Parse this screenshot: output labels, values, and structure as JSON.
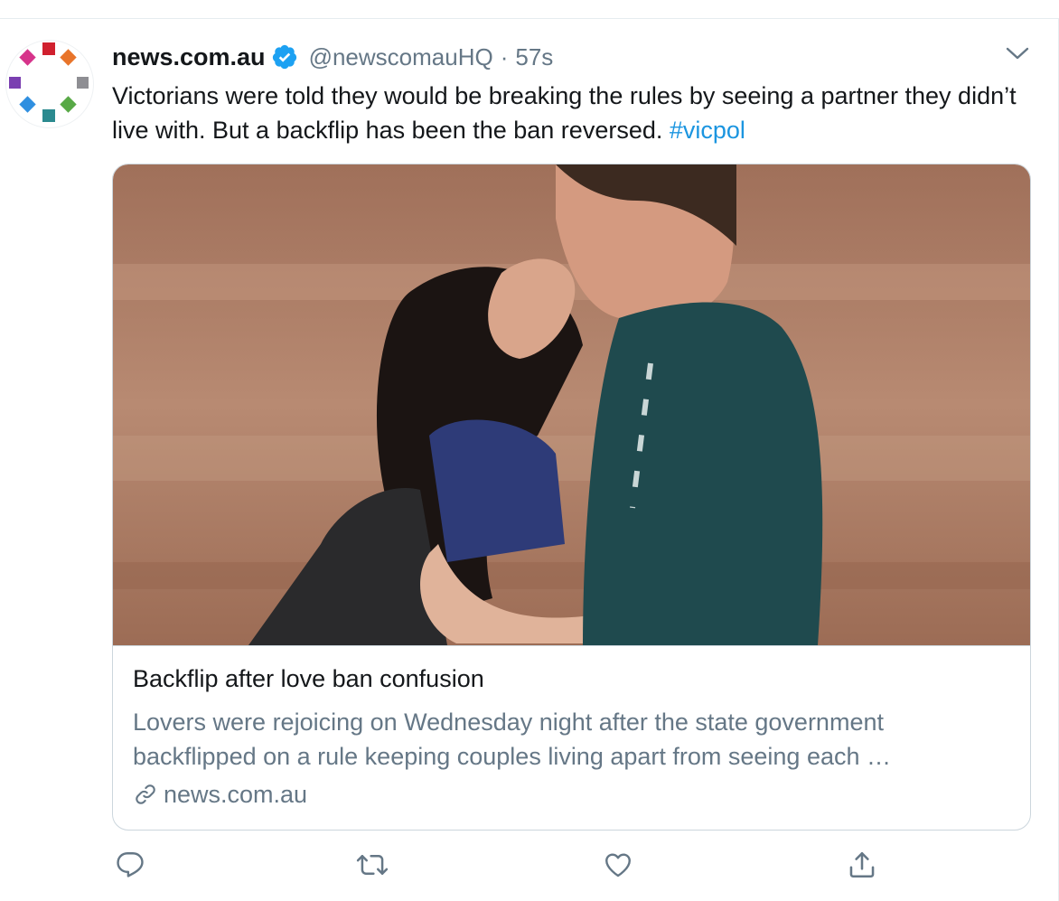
{
  "tweet": {
    "display_name": "news.com.au",
    "handle": "@newscomauHQ",
    "separator": "·",
    "time": "57s",
    "text": "Victorians were told they would be breaking the rules by seeing a partner they didn’t live with. But a backflip has been the ban reversed.",
    "hashtag": "#vicpol"
  },
  "card": {
    "title": "Backflip after love ban confusion",
    "description": "Lovers were rejoicing on Wednesday night after the state government backflipped on a rule keeping couples living apart from seeing each …",
    "source": "news.com.au"
  },
  "icons": {
    "verified": "verified-badge-icon",
    "caret": "chevron-down-icon",
    "reply": "reply-icon",
    "retweet": "retweet-icon",
    "like": "heart-icon",
    "share": "share-icon",
    "link": "link-icon"
  },
  "colors": {
    "accent": "#1da1f2",
    "hashtag": "#1b95e0",
    "secondary_text": "#657786",
    "primary_text": "#14171a"
  }
}
